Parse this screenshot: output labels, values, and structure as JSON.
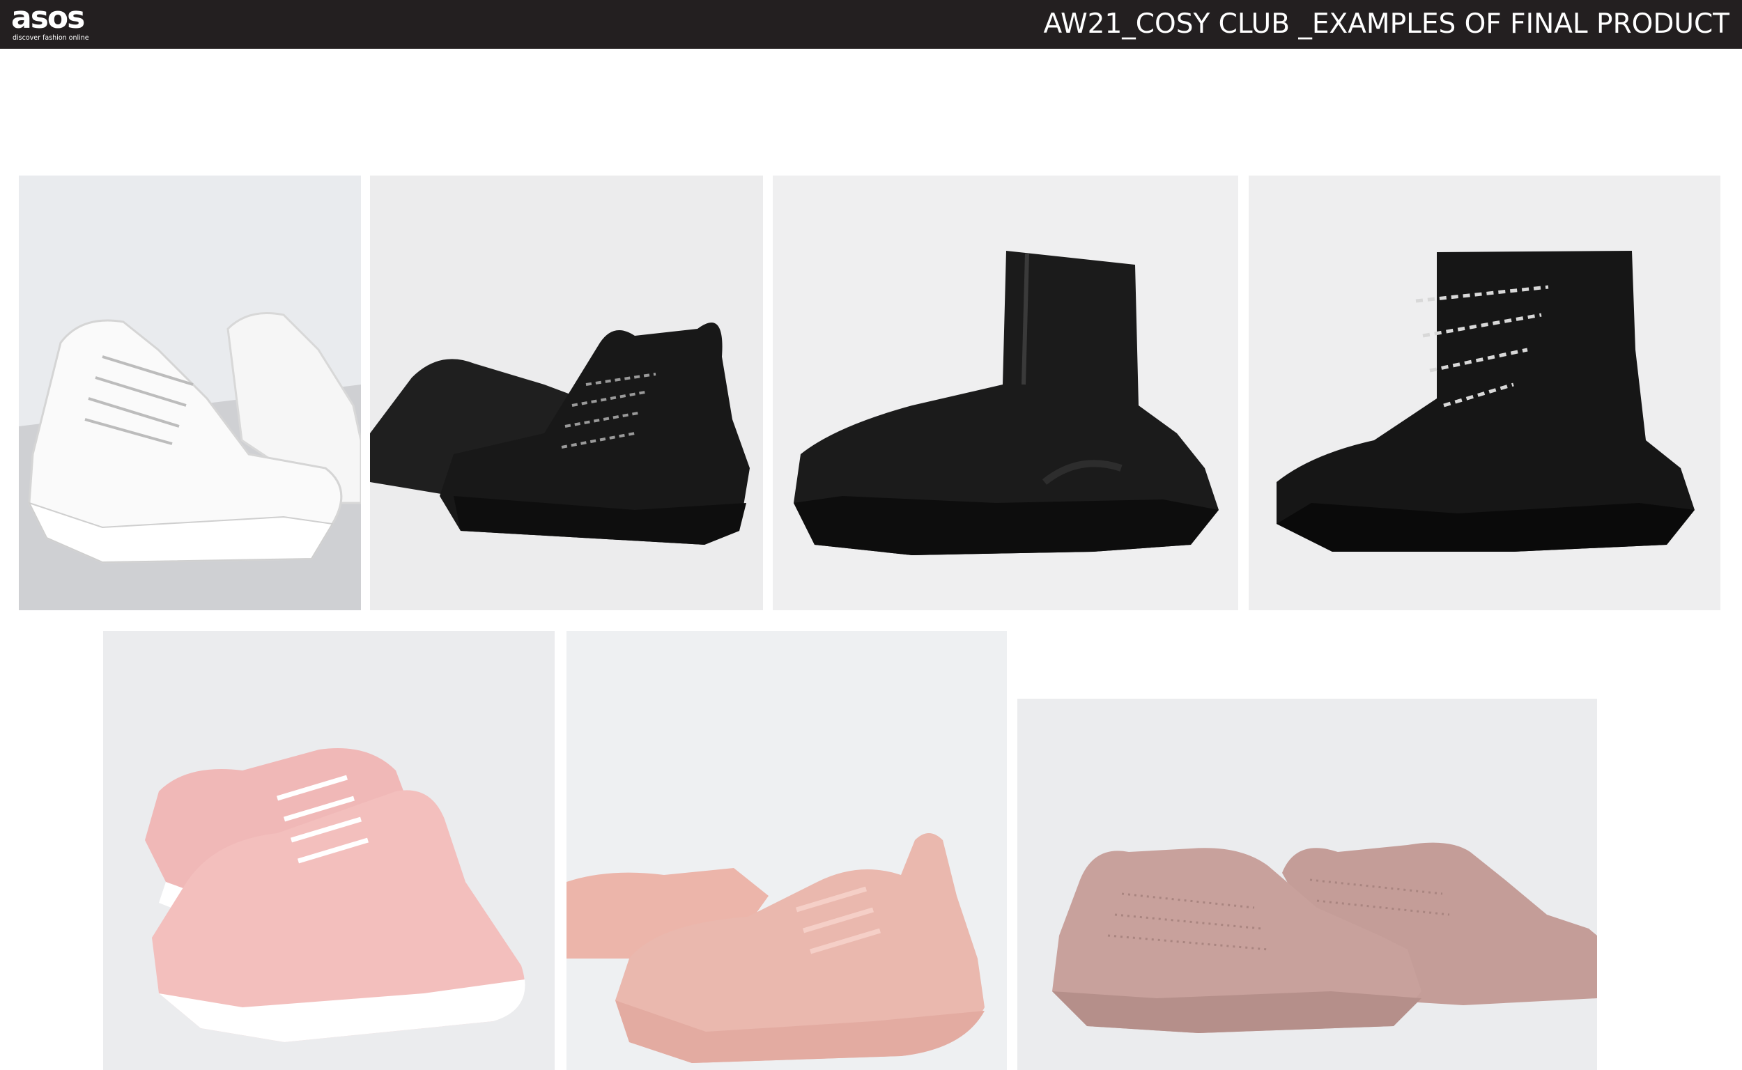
{
  "header": {
    "logo_text": "asos",
    "logo_tagline": "discover fashion online",
    "title": "AW21_COSY CLUB _EXAMPLES OF FINAL PRODUCT"
  },
  "colors": {
    "header_bg": "#231f20",
    "header_text": "#ffffff",
    "page_bg": "#ffffff"
  },
  "products": [
    {
      "name": "white-chunky-hiker-sneaker",
      "color": "#f4f4f4"
    },
    {
      "name": "black-chunky-hiker-sneaker",
      "color": "#1c1c1c"
    },
    {
      "name": "black-zip-sock-boot",
      "color": "#1a1a1a"
    },
    {
      "name": "black-lace-up-sock-sneaker",
      "color": "#151515"
    },
    {
      "name": "pink-zip-runner-sneaker",
      "color": "#eeb7b6"
    },
    {
      "name": "pink-chunky-sneaker",
      "color": "#e8b7ad"
    },
    {
      "name": "dusty-pink-knit-sneaker",
      "color": "#c9a29d"
    }
  ]
}
